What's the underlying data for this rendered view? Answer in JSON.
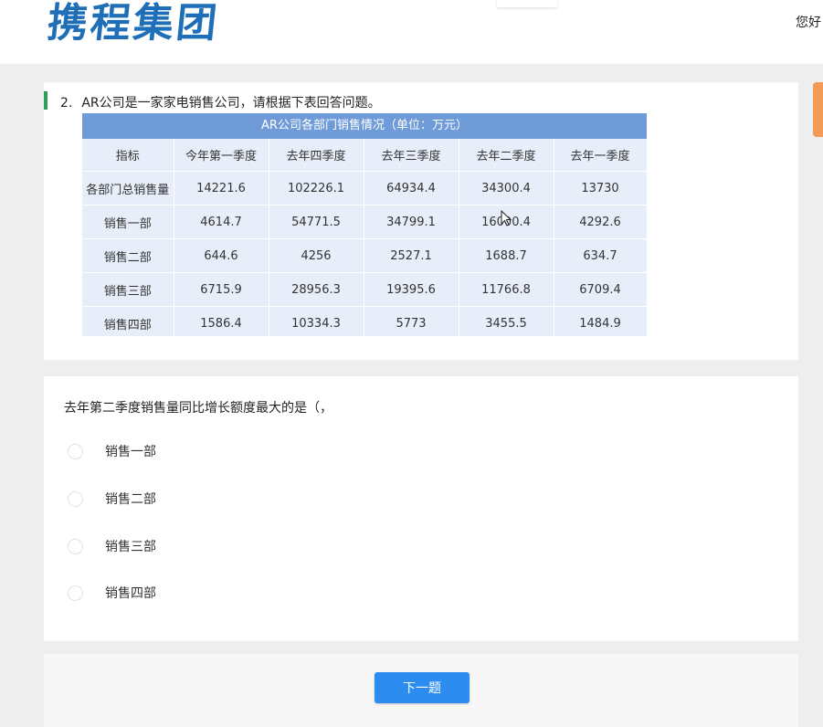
{
  "header": {
    "logo_text": "携程集团",
    "greeting": "您好"
  },
  "question": {
    "number": "2.",
    "text": "AR公司是一家家电销售公司，请根据下表回答问题。"
  },
  "table": {
    "caption": "AR公司各部门销售情况（单位：万元）",
    "headers": [
      "指标",
      "今年第一季度",
      "去年四季度",
      "去年三季度",
      "去年二季度",
      "去年一季度"
    ],
    "rows": [
      [
        "各部门总销售量",
        "14221.6",
        "102226.1",
        "64934.4",
        "34300.4",
        "13730"
      ],
      [
        "销售一部",
        "4614.7",
        "54771.5",
        "34799.1",
        "16000.4",
        "4292.6"
      ],
      [
        "销售二部",
        "644.6",
        "4256",
        "2527.1",
        "1688.7",
        "634.7"
      ],
      [
        "销售三部",
        "6715.9",
        "28956.3",
        "19395.6",
        "11766.8",
        "6709.4"
      ],
      [
        "销售四部",
        "1586.4",
        "10334.3",
        "5773",
        "3455.5",
        "1484.9"
      ]
    ]
  },
  "prompt": "去年第二季度销售量同比增长额度最大的是（，",
  "options": [
    "销售一部",
    "销售二部",
    "销售三部",
    "销售四部"
  ],
  "footer": {
    "next_label": "下一题"
  },
  "colors": {
    "brand_blue": "#1f6fb8",
    "table_header": "#6f9bd8",
    "table_body": "#e7eef9",
    "button": "#2d8cf0",
    "accent_green": "#2e9e5b",
    "accent_orange": "#f39a57"
  }
}
